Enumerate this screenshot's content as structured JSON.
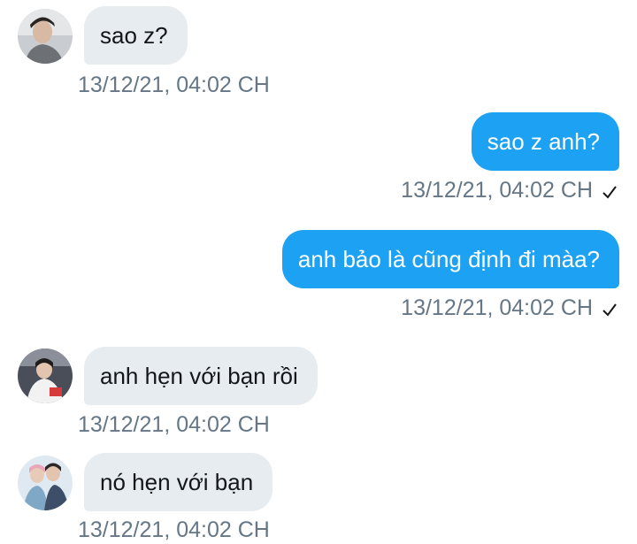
{
  "messages": [
    {
      "direction": "incoming",
      "text": "sao z?",
      "timestamp": "13/12/21, 04:02 CH",
      "avatar": "avatar-photo-1"
    },
    {
      "direction": "outgoing",
      "text": "sao z anh?",
      "timestamp": "13/12/21, 04:02 CH",
      "read": true
    },
    {
      "direction": "outgoing",
      "text": "anh bảo là cũng định đi màa?",
      "timestamp": "13/12/21, 04:02 CH",
      "read": true
    },
    {
      "direction": "incoming",
      "text": "anh hẹn với bạn rồi",
      "timestamp": "13/12/21, 04:02 CH",
      "avatar": "avatar-photo-2"
    },
    {
      "direction": "incoming",
      "text": "nó hẹn với bạn",
      "timestamp": "13/12/21, 04:02 CH",
      "avatar": "avatar-photo-3"
    }
  ],
  "colors": {
    "incoming_bubble": "#e6ecf0",
    "outgoing_bubble": "#1da1f2",
    "timestamp": "#657786"
  },
  "icons": {
    "read_receipt": "checkmark-icon"
  }
}
